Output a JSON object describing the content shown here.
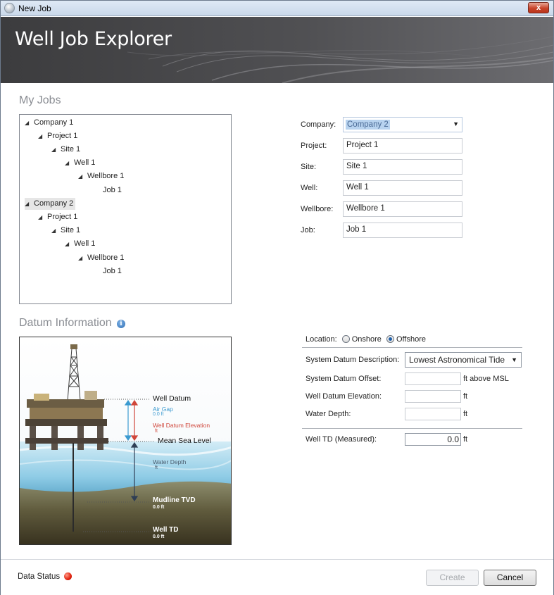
{
  "window": {
    "title": "New Job",
    "close_label": "x"
  },
  "banner": {
    "title": "Well Job Explorer"
  },
  "my_jobs": {
    "title": "My Jobs",
    "tree": [
      {
        "label": "Company 1",
        "level": 0,
        "expanded": true,
        "selected": false
      },
      {
        "label": "Project 1",
        "level": 1,
        "expanded": true,
        "selected": false
      },
      {
        "label": "Site 1",
        "level": 2,
        "expanded": true,
        "selected": false
      },
      {
        "label": "Well 1",
        "level": 3,
        "expanded": true,
        "selected": false
      },
      {
        "label": "Wellbore 1",
        "level": 4,
        "expanded": true,
        "selected": false
      },
      {
        "label": "Job 1",
        "level": 5,
        "expanded": false,
        "selected": false
      },
      {
        "label": "Company 2",
        "level": 0,
        "expanded": true,
        "selected": true
      },
      {
        "label": "Project 1",
        "level": 1,
        "expanded": true,
        "selected": false
      },
      {
        "label": "Site 1",
        "level": 2,
        "expanded": true,
        "selected": false
      },
      {
        "label": "Well 1",
        "level": 3,
        "expanded": true,
        "selected": false
      },
      {
        "label": "Wellbore 1",
        "level": 4,
        "expanded": true,
        "selected": false
      },
      {
        "label": "Job 1",
        "level": 5,
        "expanded": false,
        "selected": false
      }
    ]
  },
  "job_form": {
    "company_label": "Company:",
    "company_value": "Company 2",
    "project_label": "Project:",
    "project_value": "Project 1",
    "site_label": "Site:",
    "site_value": "Site 1",
    "well_label": "Well:",
    "well_value": "Well 1",
    "wellbore_label": "Wellbore:",
    "wellbore_value": "Wellbore 1",
    "job_label": "Job:",
    "job_value": "Job 1"
  },
  "datum": {
    "title": "Datum Information",
    "info_icon": "i",
    "diagram": {
      "well_datum": "Well Datum",
      "air_gap": "Air Gap",
      "air_gap_value": "0.0 ft",
      "well_datum_elevation": "Well Datum Elevation",
      "well_datum_elevation_unit": "ft",
      "mean_sea_level": "Mean Sea Level",
      "water_depth": "Water Depth",
      "water_depth_unit": "ft",
      "mudline_tvd": "Mudline TVD",
      "mudline_tvd_value": "0.0 ft",
      "well_td": "Well TD",
      "well_td_value": "0.0 ft"
    },
    "form": {
      "location_label": "Location:",
      "onshore_label": "Onshore",
      "offshore_label": "Offshore",
      "location_selected": "Offshore",
      "system_datum_description_label": "System Datum Description:",
      "system_datum_description_value": "Lowest Astronomical Tide",
      "system_datum_offset_label": "System Datum Offset:",
      "system_datum_offset_value": "",
      "system_datum_offset_unit": "ft above MSL",
      "well_datum_elevation_label": "Well Datum Elevation:",
      "well_datum_elevation_value": "",
      "well_datum_elevation_unit": "ft",
      "water_depth_label": "Water Depth:",
      "water_depth_value": "",
      "water_depth_unit": "ft",
      "well_td_label": "Well TD (Measured):",
      "well_td_value": "0.0",
      "well_td_unit": "ft"
    }
  },
  "footer": {
    "status_label": "Data Status",
    "create_label": "Create",
    "cancel_label": "Cancel"
  },
  "colors": {
    "status": "#e2200c",
    "air_gap_text": "#3b9ad0",
    "elevation_text": "#d0463a",
    "water_depth_text": "#5a6f82"
  }
}
